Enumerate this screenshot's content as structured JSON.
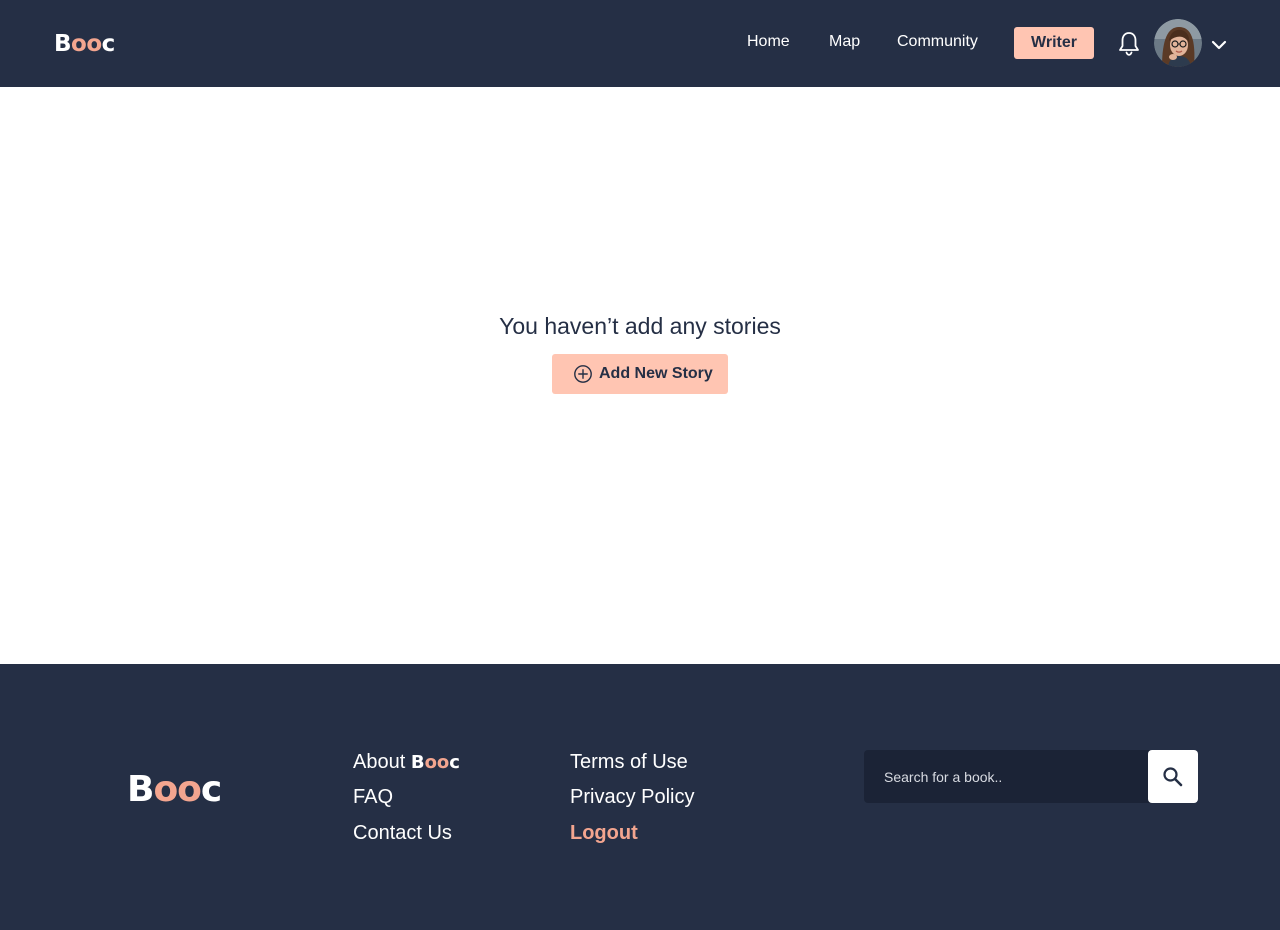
{
  "header": {
    "logo": {
      "b": "B",
      "oo": "oo",
      "c": "c"
    },
    "nav": [
      {
        "label": "Home"
      },
      {
        "label": "Map"
      },
      {
        "label": "Community"
      }
    ],
    "writer_label": "Writer",
    "icons": {
      "notifications": "bell-icon",
      "profile": "avatar",
      "menu": "chevron-down-icon"
    }
  },
  "main": {
    "empty_message": "You haven’t add any stories",
    "add_story_label": "Add New Story",
    "add_story_icon": "plus-circle-icon"
  },
  "footer": {
    "logo": {
      "b": "B",
      "oo": "oo",
      "c": "c"
    },
    "links_col1": {
      "about_prefix": "About ",
      "about_brand": {
        "b": "B",
        "oo": "oo",
        "c": "c"
      },
      "faq": "FAQ",
      "contact": "Contact Us"
    },
    "links_col2": {
      "terms": "Terms of Use",
      "privacy": "Privacy Policy",
      "logout": "Logout"
    },
    "search": {
      "placeholder": "Search for a book..",
      "value": "",
      "icon": "search-icon"
    }
  },
  "colors": {
    "navy": "#252f45",
    "navy_dark": "#1b2336",
    "peach": "#ffc5b2",
    "coral": "#f3a58f",
    "white": "#ffffff"
  }
}
